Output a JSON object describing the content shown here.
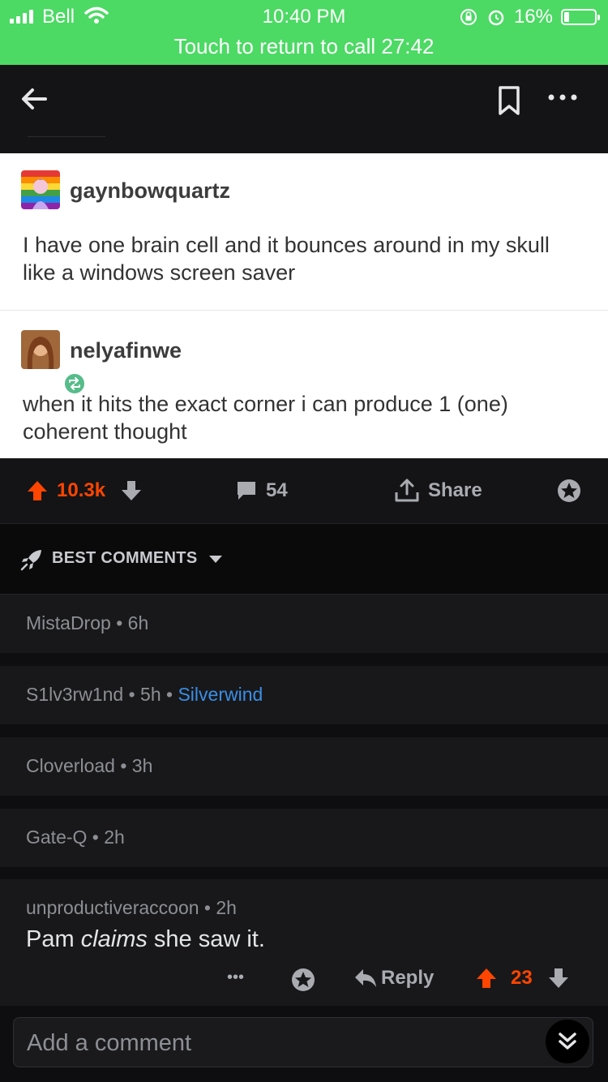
{
  "status_bar": {
    "carrier": "Bell",
    "time": "10:40 PM",
    "battery": "16%",
    "battery_level": 0.16,
    "call_banner": "Touch to return to call 27:42"
  },
  "posts": [
    {
      "username": "gaynbowquartz",
      "text": "I have one brain cell and it bounces around in my skull like a windows screen saver"
    },
    {
      "username": "nelyafinwe",
      "text": "when it hits the exact corner i can produce 1 (one) coherent thought"
    }
  ],
  "actions": {
    "upvotes": "10.3k",
    "comments": "54",
    "share": "Share"
  },
  "sort": {
    "label": "BEST COMMENTS"
  },
  "comments": [
    {
      "author": "MistaDrop",
      "age": "6h",
      "flair": ""
    },
    {
      "author": "S1lv3rw1nd",
      "age": "5h",
      "flair": "Silverwind"
    },
    {
      "author": "Cloverload",
      "age": "3h",
      "flair": ""
    },
    {
      "author": "Gate-Q",
      "age": "2h",
      "flair": ""
    }
  ],
  "open_comment": {
    "author": "unproductiveraccoon",
    "age": "2h",
    "text_before": "Pam ",
    "text_emphasis": "claims",
    "text_after": " she saw it.",
    "more": "•••",
    "reply": "Reply",
    "score": "23"
  },
  "composer": {
    "placeholder": "Add a comment"
  },
  "colors": {
    "status_green": "#4cd964",
    "upvote": "#ff4500",
    "flair": "#3a8ee6"
  }
}
